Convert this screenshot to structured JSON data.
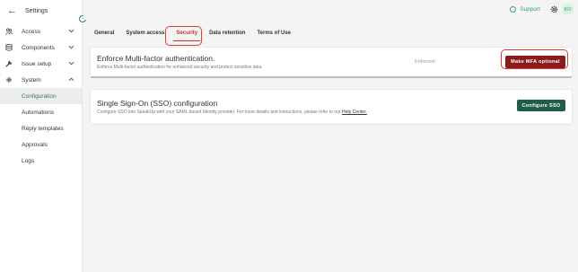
{
  "sidebar": {
    "back_icon": "back-arrow-icon",
    "title": "Settings",
    "collapse_icon": "collapse-icon",
    "groups": [
      {
        "label": "Access",
        "icon": "people-icon",
        "expanded": false
      },
      {
        "label": "Components",
        "icon": "database-icon",
        "expanded": false
      },
      {
        "label": "Issue setup",
        "icon": "wrench-icon",
        "expanded": false
      },
      {
        "label": "System",
        "icon": "gear-icon",
        "expanded": true
      }
    ],
    "system_items": [
      {
        "label": "Configuration",
        "active": true
      },
      {
        "label": "Automations",
        "active": false
      },
      {
        "label": "Reply templates",
        "active": false
      },
      {
        "label": "Approvals",
        "active": false
      },
      {
        "label": "Logs",
        "active": false
      }
    ]
  },
  "topbar": {
    "support_label": "Support",
    "settings_icon": "gear-icon",
    "avatar_initials": "KO"
  },
  "tabs": [
    {
      "label": "General",
      "active": false
    },
    {
      "label": "System access",
      "active": false
    },
    {
      "label": "Security",
      "active": true
    },
    {
      "label": "Data retention",
      "active": false
    },
    {
      "label": "Terms of Use",
      "active": false
    }
  ],
  "mfa": {
    "title": "Enforce Multi-factor authentication.",
    "description": "Enforce Multi-factor authentication for enhanced security and protect sensitive data.",
    "status": "Enforced",
    "button_label": "Make MFA optional"
  },
  "sso": {
    "title": "Single Sign-On (SSO) configuration",
    "description": "Configure SSO into SpeakUp with your SAML based Identity provider. For more details and instructions, please refer to our ",
    "link_label": "Help Center.",
    "button_label": "Configure SSO"
  },
  "colors": {
    "accent_green": "#3aa46a",
    "danger_red": "#8b1a1a",
    "sso_green": "#1f5f48",
    "highlight_red": "#e53935"
  }
}
